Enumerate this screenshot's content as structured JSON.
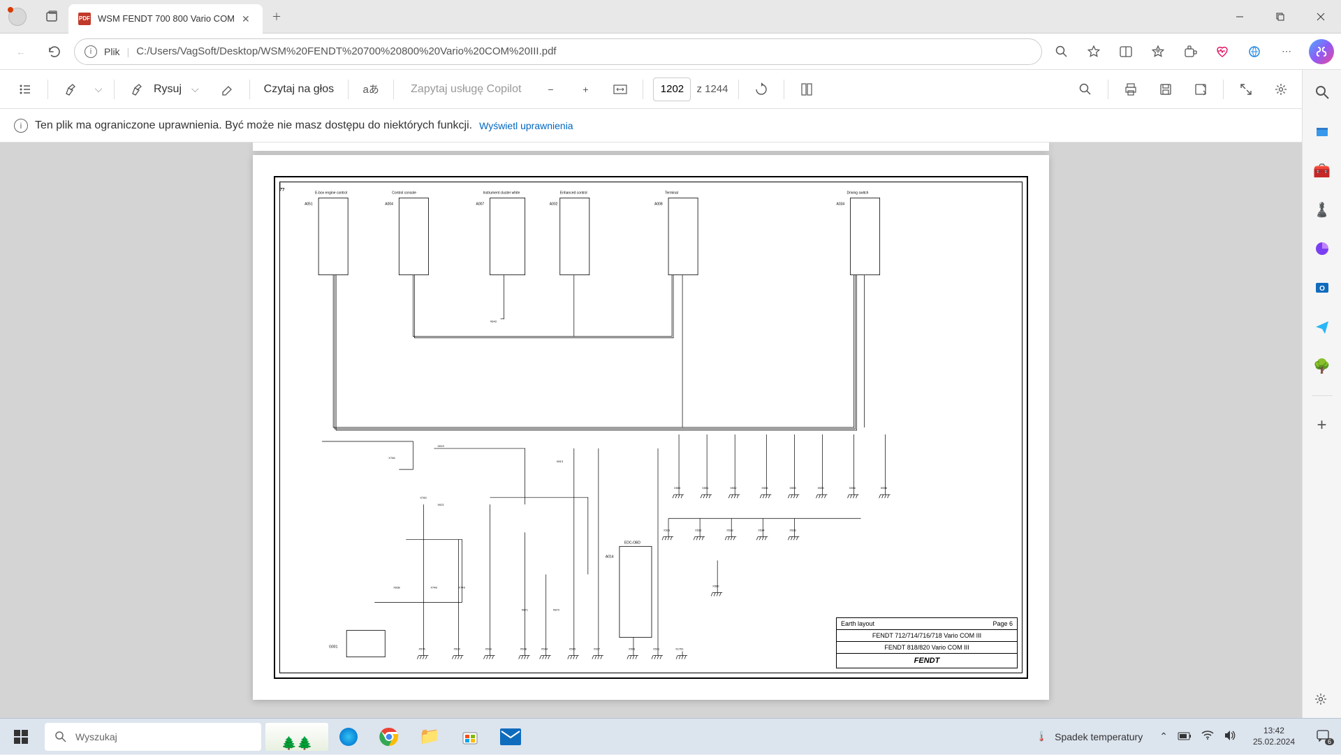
{
  "browser": {
    "tab_title": "WSM FENDT 700 800 Vario COM",
    "tab_icon_text": "PDF",
    "url_prefix": "Plik",
    "url": "C:/Users/VagSoft/Desktop/WSM%20FENDT%20700%20800%20Vario%20COM%20III.pdf"
  },
  "pdf_toolbar": {
    "draw": "Rysuj",
    "read_aloud": "Czytaj na głos",
    "copilot_placeholder": "Zapytaj usługę Copilot",
    "page_current": "1202",
    "page_total": "z 1244"
  },
  "info_bar": {
    "message": "Ten plik ma ograniczone uprawnienia. Być może nie masz dostępu do niektórych funkcji.",
    "link": "Wyświetl uprawnienia"
  },
  "diagram": {
    "components": {
      "c0": "E-box engine control",
      "c1": "Control console",
      "c2": "Instrument cluster white",
      "c3": "Enhanced control",
      "c4": "Terminal",
      "c5": "Driving switch"
    },
    "ids": {
      "a051": "A051",
      "a004": "A004",
      "a007": "A007",
      "a002": "A002",
      "a008": "A008",
      "a034": "A034",
      "a014": "A014",
      "g001": "G001"
    },
    "x_labels": {
      "x643": "X643",
      "x746": "X746",
      "x619": "X619",
      "x760": "X760",
      "x621": "X621",
      "x638": "X638",
      "x748": "X748",
      "x749": "X749",
      "x871": "X871",
      "x872": "X872",
      "x813": "X813",
      "x575": "X575",
      "x500": "X500",
      "x503": "X503",
      "x508": "X508",
      "x504": "X504",
      "x505": "X505",
      "x507": "X507",
      "x506": "X506",
      "x501": "X501",
      "x1751": "X1751",
      "x550": "X550",
      "x551": "X551",
      "x552": "X552",
      "x554": "X554",
      "x553": "X553",
      "x555": "X555",
      "x556": "X556",
      "x558": "X558",
      "x531": "X531",
      "x532": "X532",
      "x533": "X533",
      "x534": "X534",
      "x536": "X536",
      "x580": "X580"
    },
    "edc": "EDC-OBD",
    "title_block": {
      "row1_left": "Earth layout",
      "row1_right": "Page 6",
      "row2": "FENDT 712/714/716/718 Vario COM III",
      "row3": "FENDT 818/820 Vario COM III",
      "logo": "FENDT"
    }
  },
  "taskbar": {
    "search_placeholder": "Wyszukaj",
    "weather": "Spadek temperatury",
    "time": "13:42",
    "date": "25.02.2024",
    "notif_count": "6"
  }
}
